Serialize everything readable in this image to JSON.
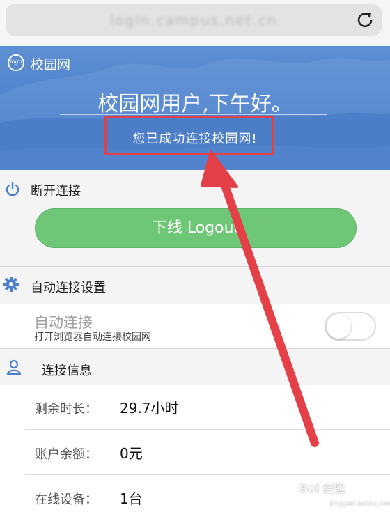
{
  "browser": {
    "url": "login.campus.net.cn",
    "reload_icon": "reload-icon"
  },
  "hero": {
    "logo_text": "logo",
    "brand": "校园网",
    "greeting": "校园网用户,下午好。",
    "status_message": "您已成功连接校园网!"
  },
  "disconnect": {
    "icon": "power-icon",
    "title": "断开连接",
    "logout_label": "下线 Logout"
  },
  "auto_connect": {
    "icon": "gear-icon",
    "title": "自动连接设置",
    "option_title": "自动连接",
    "option_desc": "打开浏览器自动连接校园网",
    "enabled": false
  },
  "connection_info": {
    "icon": "user-icon",
    "title": "连接信息",
    "rows": [
      {
        "label": "剩余时长：",
        "value": "29.7小时"
      },
      {
        "label": "账户余额：",
        "value": "0元"
      },
      {
        "label": "在线设备：",
        "value": "1台"
      }
    ]
  },
  "annotation": {
    "highlight_color": "#e44047"
  },
  "watermark": {
    "text": "Bai 经验",
    "url": "jingyan.baidu.com"
  }
}
